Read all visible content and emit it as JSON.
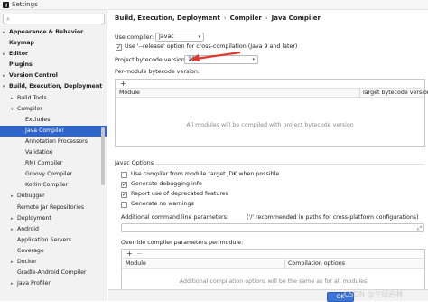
{
  "window": {
    "title": "Settings",
    "app_icon_text": "IJ"
  },
  "sidebar": {
    "search_placeholder": "",
    "items": [
      {
        "label": "Appearance & Behavior",
        "bold": true,
        "arrow": "▸",
        "indent": 0
      },
      {
        "label": "Keymap",
        "bold": true,
        "arrow": "",
        "indent": 0
      },
      {
        "label": "Editor",
        "bold": true,
        "arrow": "▸",
        "indent": 0
      },
      {
        "label": "Plugins",
        "bold": true,
        "arrow": "",
        "indent": 0
      },
      {
        "label": "Version Control",
        "bold": true,
        "arrow": "▸",
        "indent": 0
      },
      {
        "label": "Build, Execution, Deployment",
        "bold": true,
        "arrow": "▾",
        "indent": 0
      },
      {
        "label": "Build Tools",
        "bold": false,
        "arrow": "▸",
        "indent": 1
      },
      {
        "label": "Compiler",
        "bold": false,
        "arrow": "▾",
        "indent": 1
      },
      {
        "label": "Excludes",
        "bold": false,
        "arrow": "",
        "indent": 2
      },
      {
        "label": "Java Compiler",
        "bold": false,
        "arrow": "",
        "indent": 2,
        "selected": true
      },
      {
        "label": "Annotation Processors",
        "bold": false,
        "arrow": "",
        "indent": 2
      },
      {
        "label": "Validation",
        "bold": false,
        "arrow": "",
        "indent": 2
      },
      {
        "label": "RMI Compiler",
        "bold": false,
        "arrow": "",
        "indent": 2
      },
      {
        "label": "Groovy Compiler",
        "bold": false,
        "arrow": "",
        "indent": 2
      },
      {
        "label": "Kotlin Compiler",
        "bold": false,
        "arrow": "",
        "indent": 2
      },
      {
        "label": "Debugger",
        "bold": false,
        "arrow": "▸",
        "indent": 1
      },
      {
        "label": "Remote Jar Repositories",
        "bold": false,
        "arrow": "",
        "indent": 1
      },
      {
        "label": "Deployment",
        "bold": false,
        "arrow": "▸",
        "indent": 1
      },
      {
        "label": "Android",
        "bold": false,
        "arrow": "▸",
        "indent": 1
      },
      {
        "label": "Application Servers",
        "bold": false,
        "arrow": "",
        "indent": 1
      },
      {
        "label": "Coverage",
        "bold": false,
        "arrow": "",
        "indent": 1
      },
      {
        "label": "Docker",
        "bold": false,
        "arrow": "▸",
        "indent": 1
      },
      {
        "label": "Gradle-Android Compiler",
        "bold": false,
        "arrow": "",
        "indent": 1
      },
      {
        "label": "Java Profiler",
        "bold": false,
        "arrow": "▸",
        "indent": 1
      }
    ]
  },
  "breadcrumb": {
    "parts": [
      "Build, Execution, Deployment",
      "Compiler",
      "Java Compiler"
    ],
    "separator": "›"
  },
  "form": {
    "use_compiler_label": "Use compiler:",
    "use_compiler_value": "Javac",
    "release_option_label": "Use '--release' option for cross-compilation (Java 9 and later)",
    "release_option_checked": true,
    "project_bytecode_label": "Project bytecode version:",
    "project_bytecode_value": "16",
    "per_module_label": "Per-module bytecode version:",
    "per_module_table": {
      "add_label": "+",
      "remove_label": "−",
      "columns": [
        "Module",
        "Target bytecode version"
      ],
      "empty_text": "All modules will be compiled with project bytecode version"
    },
    "javac_section_title": "Javac Options",
    "javac_options": [
      {
        "label": "Use compiler from module target JDK when possible",
        "checked": false
      },
      {
        "label": "Generate debugging info",
        "checked": true
      },
      {
        "label": "Report use of deprecated features",
        "checked": true
      },
      {
        "label": "Generate no warnings",
        "checked": false
      }
    ],
    "additional_params_label": "Additional command line parameters:",
    "additional_params_hint": "('/' recommended in paths for cross-platform configurations)",
    "additional_params_value": "",
    "override_label": "Override compiler parameters per-module:",
    "override_table": {
      "add_label": "+",
      "remove_label": "−",
      "columns": [
        "Module",
        "Compilation options"
      ],
      "empty_text": "Additional compilation options will be the same as for all modules"
    }
  },
  "buttons": {
    "ok_label": "OK"
  },
  "watermark": "CSDN @兰绿启林",
  "colors": {
    "selection": "#2f65ca",
    "annotation_arrow": "#e8342c"
  }
}
